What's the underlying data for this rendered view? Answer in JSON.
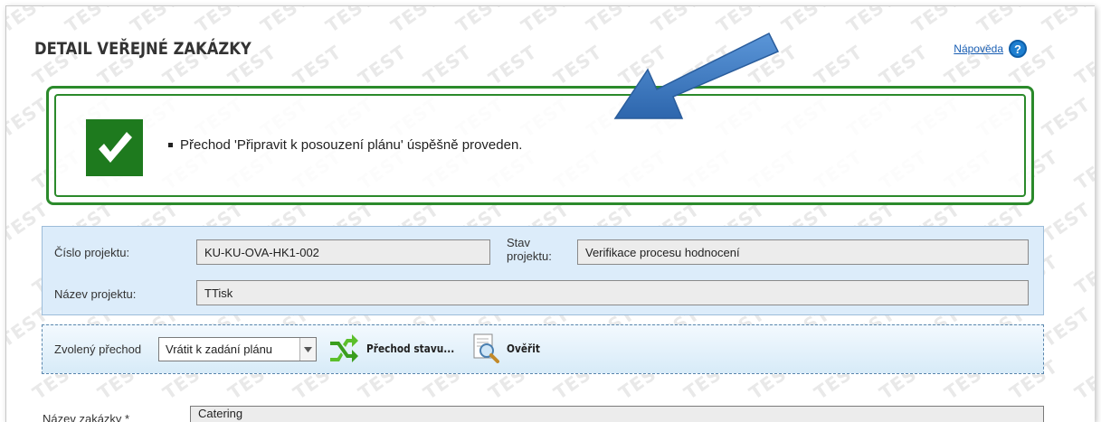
{
  "page": {
    "title": "DETAIL VEŘEJNÉ ZAKÁZKY",
    "help_label": "Nápověda",
    "watermark_text": "TEST"
  },
  "success_message": {
    "text": "Přechod 'Připravit k posouzení plánu' úspěšně proveden.",
    "icon": "checkmark-icon",
    "color": "#1e7a1e"
  },
  "project": {
    "number_label": "Číslo projektu:",
    "number_value": "KU-KU-OVA-HK1-002",
    "state_label_line1": "Stav",
    "state_label_line2": "projektu:",
    "state_value": "Verifikace procesu hodnocení",
    "name_label": "Název projektu:",
    "name_value": "TTisk"
  },
  "transition": {
    "label": "Zvolený přechod",
    "selected": "Vrátit k zadání plánu",
    "transition_button": "Přechod stavu...",
    "verify_button": "Ověřit"
  },
  "contract": {
    "name_label": "Název zakázky *",
    "name_value": "Catering"
  },
  "colors": {
    "success_green": "#2b8a2b",
    "panel_blue": "#dcecfa",
    "arrow_blue": "#3b78c4"
  }
}
